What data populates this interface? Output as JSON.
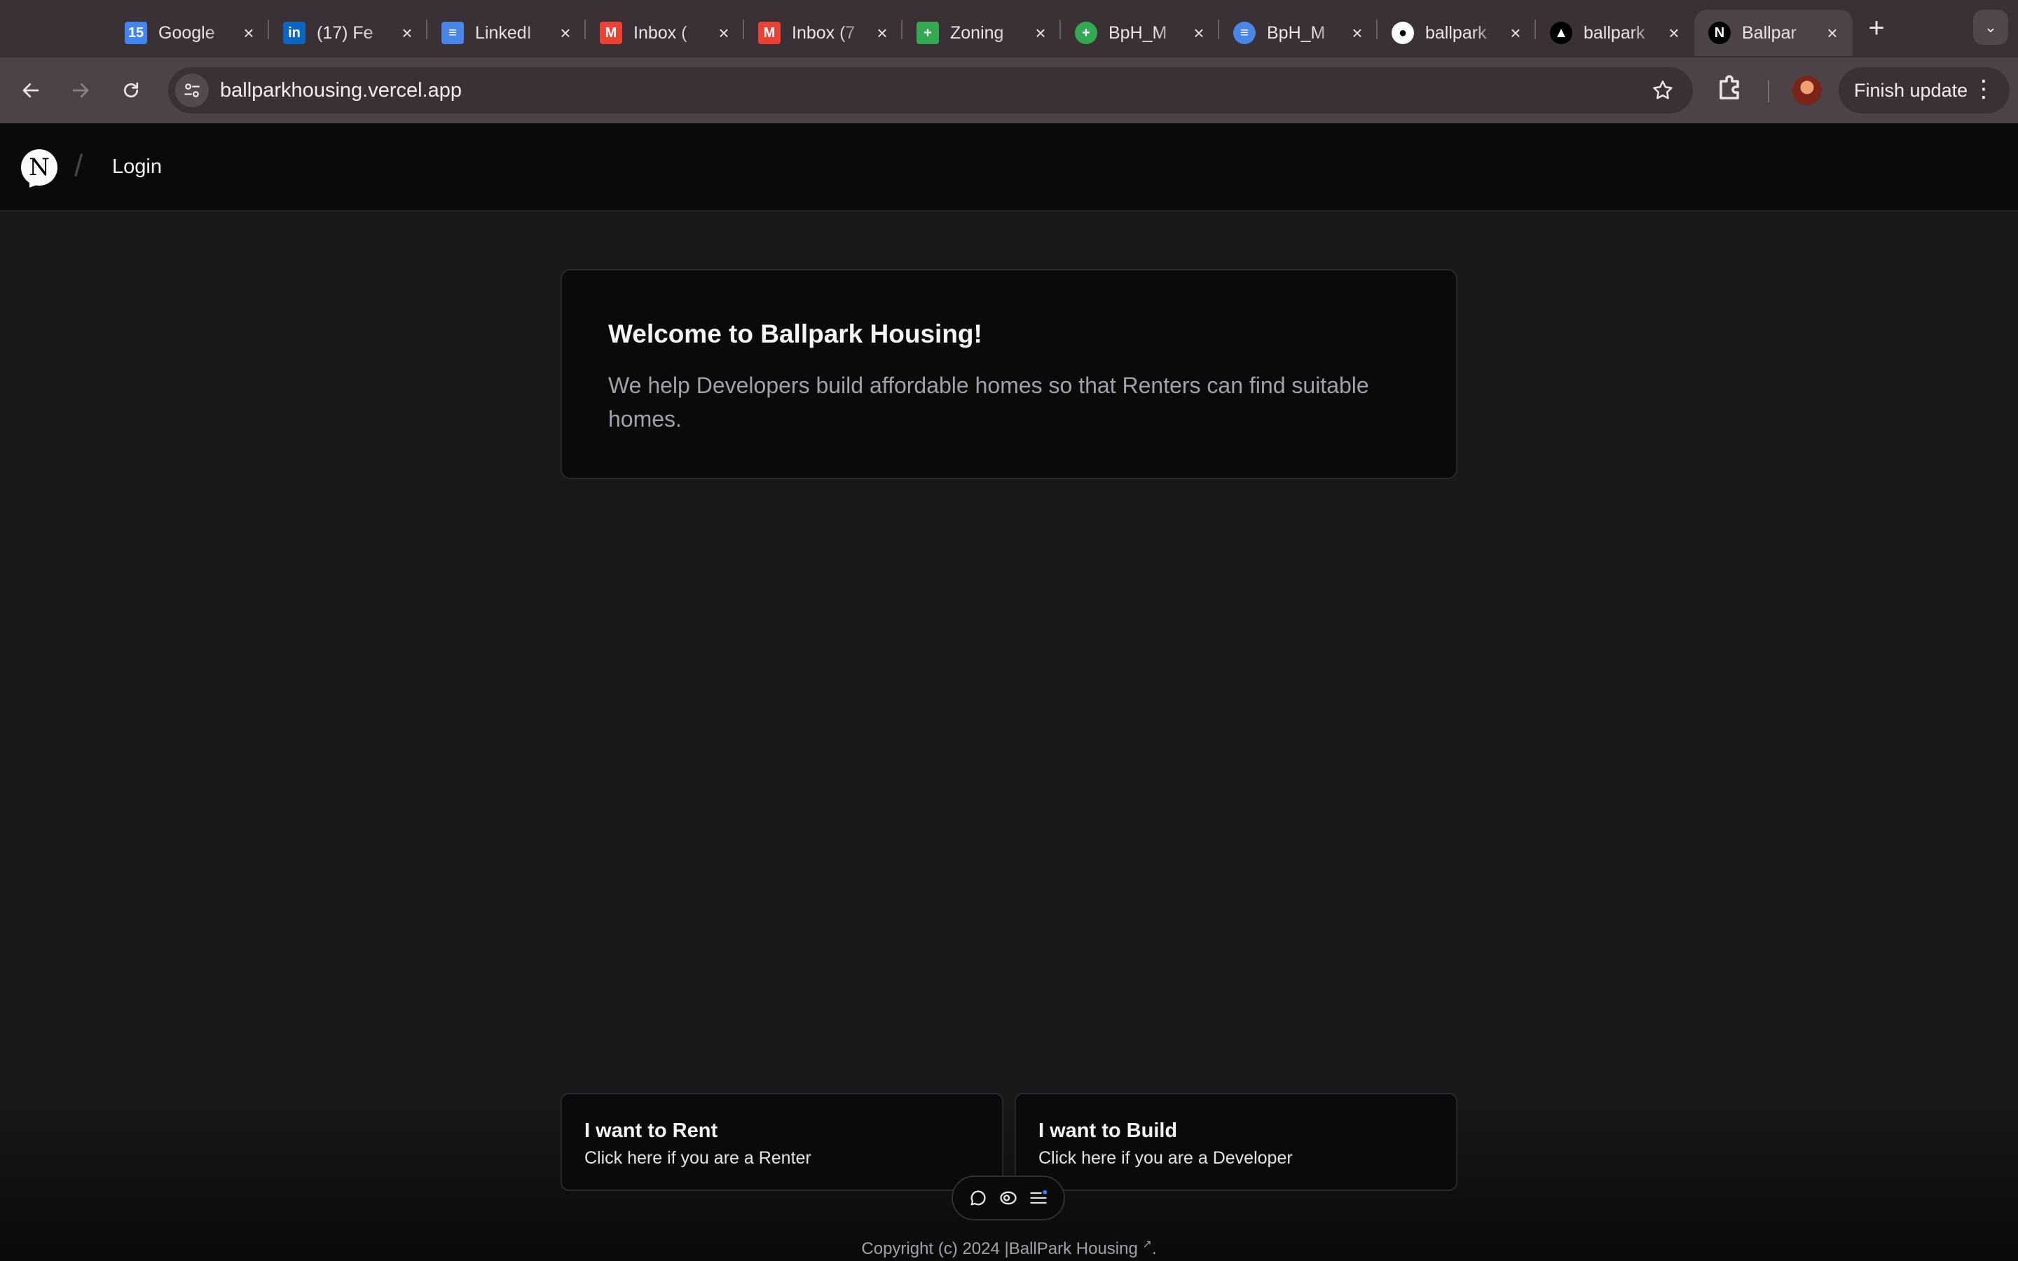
{
  "browser": {
    "tabs": [
      {
        "title": "Google",
        "icon": "google-calendar-icon",
        "color": "#4285f4",
        "glyph": "15"
      },
      {
        "title": "(17) Fe",
        "icon": "linkedin-icon",
        "color": "#0a66c2",
        "glyph": "in"
      },
      {
        "title": "LinkedI",
        "icon": "google-docs-icon",
        "color": "#4a86e8",
        "glyph": "≡"
      },
      {
        "title": "Inbox (",
        "icon": "gmail-icon",
        "color": "#ea4335",
        "glyph": "M"
      },
      {
        "title": "Inbox (7",
        "icon": "gmail-icon",
        "color": "#ea4335",
        "glyph": "M"
      },
      {
        "title": "Zoning",
        "icon": "google-sheets-icon",
        "color": "#34a853",
        "glyph": "+"
      },
      {
        "title": "BpH_M",
        "icon": "sheets-circle-icon",
        "color": "#34a853",
        "glyph": "+"
      },
      {
        "title": "BpH_M",
        "icon": "docs-circle-icon",
        "color": "#4a86e8",
        "glyph": "≡"
      },
      {
        "title": "ballpark",
        "icon": "github-icon",
        "color": "#ffffff",
        "glyph": "●"
      },
      {
        "title": "ballpark",
        "icon": "vercel-icon",
        "color": "#000000",
        "glyph": "▲"
      },
      {
        "title": "Ballpar",
        "icon": "nextjs-icon",
        "color": "#000000",
        "glyph": "N"
      }
    ],
    "url": "ballparkhousing.vercel.app",
    "finish_update_label": "Finish update"
  },
  "header": {
    "logo_letter": "N",
    "separator": "/",
    "login_label": "Login"
  },
  "welcome": {
    "title": "Welcome to Ballpark Housing!",
    "body": "We help Developers build affordable homes so that Renters can find suitable homes."
  },
  "choices": {
    "rent": {
      "title": "I want to Rent",
      "subtitle": "Click here if you are a Renter"
    },
    "build": {
      "title": "I want to Build",
      "subtitle": "Click here if you are a Developer"
    }
  },
  "footer": {
    "copyright": "Copyright (c) 2024 |BallPark Housing",
    "link_suffix": "↗",
    "period": "."
  }
}
